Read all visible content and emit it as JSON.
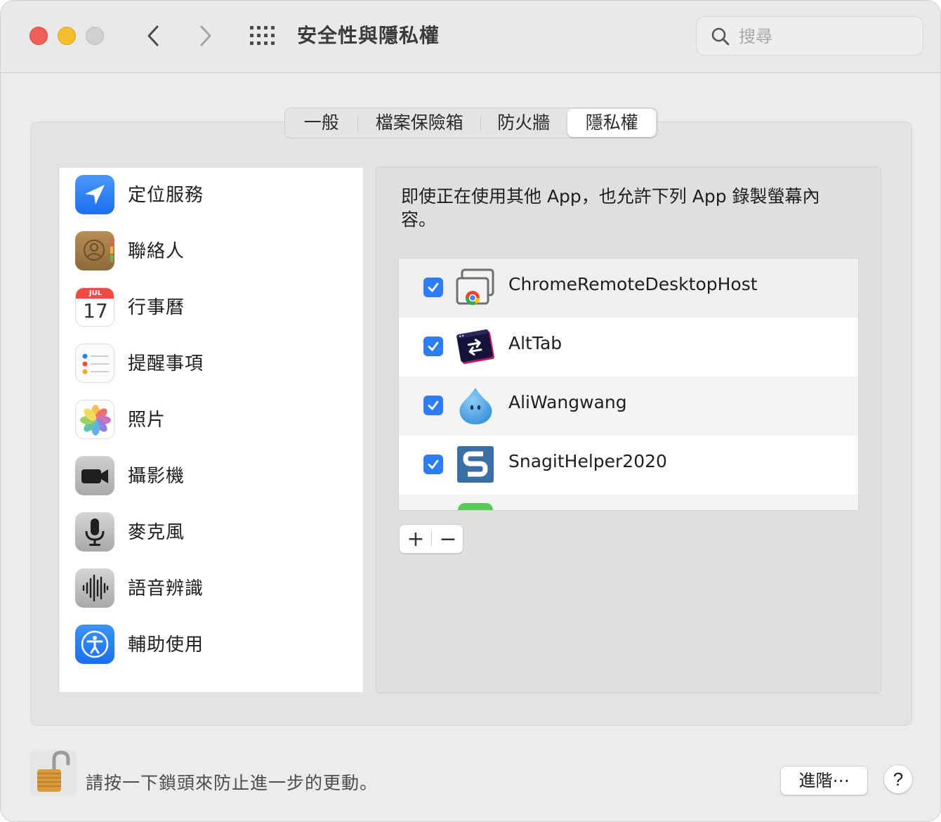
{
  "window": {
    "title": "安全性與隱私權",
    "search_placeholder": "搜尋"
  },
  "tabs": [
    {
      "label": "一般",
      "active": false
    },
    {
      "label": "檔案保險箱",
      "active": false
    },
    {
      "label": "防火牆",
      "active": false
    },
    {
      "label": "隱私權",
      "active": true
    }
  ],
  "sidebar": {
    "items": [
      {
        "label": "定位服務",
        "icon": "location-arrow-icon"
      },
      {
        "label": "聯絡人",
        "icon": "contacts-icon"
      },
      {
        "label": "行事曆",
        "icon": "calendar-icon",
        "icon_month": "JUL",
        "icon_day": "17"
      },
      {
        "label": "提醒事項",
        "icon": "reminders-icon"
      },
      {
        "label": "照片",
        "icon": "photos-icon"
      },
      {
        "label": "攝影機",
        "icon": "camera-icon"
      },
      {
        "label": "麥克風",
        "icon": "microphone-icon"
      },
      {
        "label": "語音辨識",
        "icon": "speech-recognition-icon"
      },
      {
        "label": "輔助使用",
        "icon": "accessibility-icon"
      }
    ]
  },
  "main": {
    "description": "即使正在使用其他 App，也允許下列 App 錄製螢幕內容。",
    "apps": [
      {
        "name": "ChromeRemoteDesktopHost",
        "checked": true,
        "icon": "chrome-remote-desktop-icon"
      },
      {
        "name": "AltTab",
        "checked": true,
        "icon": "alttab-icon"
      },
      {
        "name": "AliWangwang",
        "checked": true,
        "icon": "aliwangwang-icon"
      },
      {
        "name": "SnagitHelper2020",
        "checked": true,
        "icon": "snagit-icon"
      }
    ],
    "add_label": "+",
    "remove_label": "−"
  },
  "footer": {
    "lock_text": "請按一下鎖頭來防止進一步的更動。",
    "advanced_label": "進階⋯",
    "help_label": "?"
  },
  "colors": {
    "accent": "#2f7df6",
    "close": "#ee5f57",
    "minimize": "#f4bd2f"
  }
}
